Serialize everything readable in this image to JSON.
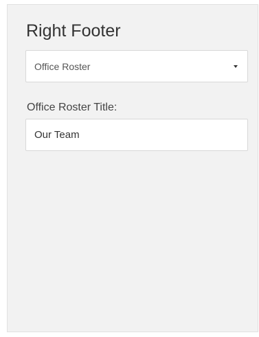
{
  "panel": {
    "title": "Right Footer",
    "select": {
      "selected": "Office Roster",
      "icon": "caret-down-icon"
    },
    "field": {
      "label": "Office Roster Title:",
      "value": "Our Team"
    }
  }
}
